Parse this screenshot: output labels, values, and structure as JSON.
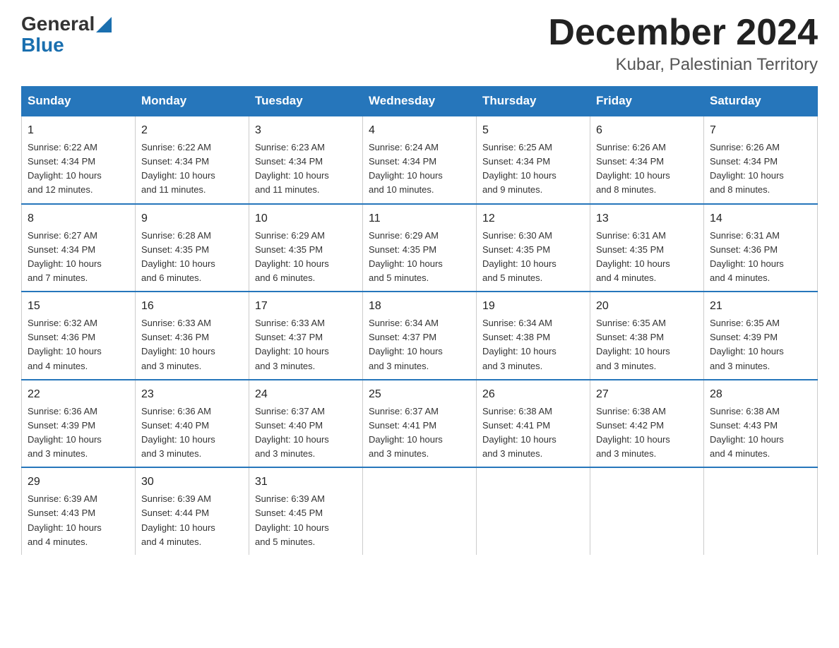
{
  "header": {
    "logo_general": "General",
    "logo_blue": "Blue",
    "month_title": "December 2024",
    "location": "Kubar, Palestinian Territory"
  },
  "days_of_week": [
    "Sunday",
    "Monday",
    "Tuesday",
    "Wednesday",
    "Thursday",
    "Friday",
    "Saturday"
  ],
  "weeks": [
    [
      {
        "day": "1",
        "sunrise": "6:22 AM",
        "sunset": "4:34 PM",
        "daylight": "10 hours and 12 minutes."
      },
      {
        "day": "2",
        "sunrise": "6:22 AM",
        "sunset": "4:34 PM",
        "daylight": "10 hours and 11 minutes."
      },
      {
        "day": "3",
        "sunrise": "6:23 AM",
        "sunset": "4:34 PM",
        "daylight": "10 hours and 11 minutes."
      },
      {
        "day": "4",
        "sunrise": "6:24 AM",
        "sunset": "4:34 PM",
        "daylight": "10 hours and 10 minutes."
      },
      {
        "day": "5",
        "sunrise": "6:25 AM",
        "sunset": "4:34 PM",
        "daylight": "10 hours and 9 minutes."
      },
      {
        "day": "6",
        "sunrise": "6:26 AM",
        "sunset": "4:34 PM",
        "daylight": "10 hours and 8 minutes."
      },
      {
        "day": "7",
        "sunrise": "6:26 AM",
        "sunset": "4:34 PM",
        "daylight": "10 hours and 8 minutes."
      }
    ],
    [
      {
        "day": "8",
        "sunrise": "6:27 AM",
        "sunset": "4:34 PM",
        "daylight": "10 hours and 7 minutes."
      },
      {
        "day": "9",
        "sunrise": "6:28 AM",
        "sunset": "4:35 PM",
        "daylight": "10 hours and 6 minutes."
      },
      {
        "day": "10",
        "sunrise": "6:29 AM",
        "sunset": "4:35 PM",
        "daylight": "10 hours and 6 minutes."
      },
      {
        "day": "11",
        "sunrise": "6:29 AM",
        "sunset": "4:35 PM",
        "daylight": "10 hours and 5 minutes."
      },
      {
        "day": "12",
        "sunrise": "6:30 AM",
        "sunset": "4:35 PM",
        "daylight": "10 hours and 5 minutes."
      },
      {
        "day": "13",
        "sunrise": "6:31 AM",
        "sunset": "4:35 PM",
        "daylight": "10 hours and 4 minutes."
      },
      {
        "day": "14",
        "sunrise": "6:31 AM",
        "sunset": "4:36 PM",
        "daylight": "10 hours and 4 minutes."
      }
    ],
    [
      {
        "day": "15",
        "sunrise": "6:32 AM",
        "sunset": "4:36 PM",
        "daylight": "10 hours and 4 minutes."
      },
      {
        "day": "16",
        "sunrise": "6:33 AM",
        "sunset": "4:36 PM",
        "daylight": "10 hours and 3 minutes."
      },
      {
        "day": "17",
        "sunrise": "6:33 AM",
        "sunset": "4:37 PM",
        "daylight": "10 hours and 3 minutes."
      },
      {
        "day": "18",
        "sunrise": "6:34 AM",
        "sunset": "4:37 PM",
        "daylight": "10 hours and 3 minutes."
      },
      {
        "day": "19",
        "sunrise": "6:34 AM",
        "sunset": "4:38 PM",
        "daylight": "10 hours and 3 minutes."
      },
      {
        "day": "20",
        "sunrise": "6:35 AM",
        "sunset": "4:38 PM",
        "daylight": "10 hours and 3 minutes."
      },
      {
        "day": "21",
        "sunrise": "6:35 AM",
        "sunset": "4:39 PM",
        "daylight": "10 hours and 3 minutes."
      }
    ],
    [
      {
        "day": "22",
        "sunrise": "6:36 AM",
        "sunset": "4:39 PM",
        "daylight": "10 hours and 3 minutes."
      },
      {
        "day": "23",
        "sunrise": "6:36 AM",
        "sunset": "4:40 PM",
        "daylight": "10 hours and 3 minutes."
      },
      {
        "day": "24",
        "sunrise": "6:37 AM",
        "sunset": "4:40 PM",
        "daylight": "10 hours and 3 minutes."
      },
      {
        "day": "25",
        "sunrise": "6:37 AM",
        "sunset": "4:41 PM",
        "daylight": "10 hours and 3 minutes."
      },
      {
        "day": "26",
        "sunrise": "6:38 AM",
        "sunset": "4:41 PM",
        "daylight": "10 hours and 3 minutes."
      },
      {
        "day": "27",
        "sunrise": "6:38 AM",
        "sunset": "4:42 PM",
        "daylight": "10 hours and 3 minutes."
      },
      {
        "day": "28",
        "sunrise": "6:38 AM",
        "sunset": "4:43 PM",
        "daylight": "10 hours and 4 minutes."
      }
    ],
    [
      {
        "day": "29",
        "sunrise": "6:39 AM",
        "sunset": "4:43 PM",
        "daylight": "10 hours and 4 minutes."
      },
      {
        "day": "30",
        "sunrise": "6:39 AM",
        "sunset": "4:44 PM",
        "daylight": "10 hours and 4 minutes."
      },
      {
        "day": "31",
        "sunrise": "6:39 AM",
        "sunset": "4:45 PM",
        "daylight": "10 hours and 5 minutes."
      },
      null,
      null,
      null,
      null
    ]
  ],
  "labels": {
    "sunrise": "Sunrise:",
    "sunset": "Sunset:",
    "daylight": "Daylight:"
  }
}
